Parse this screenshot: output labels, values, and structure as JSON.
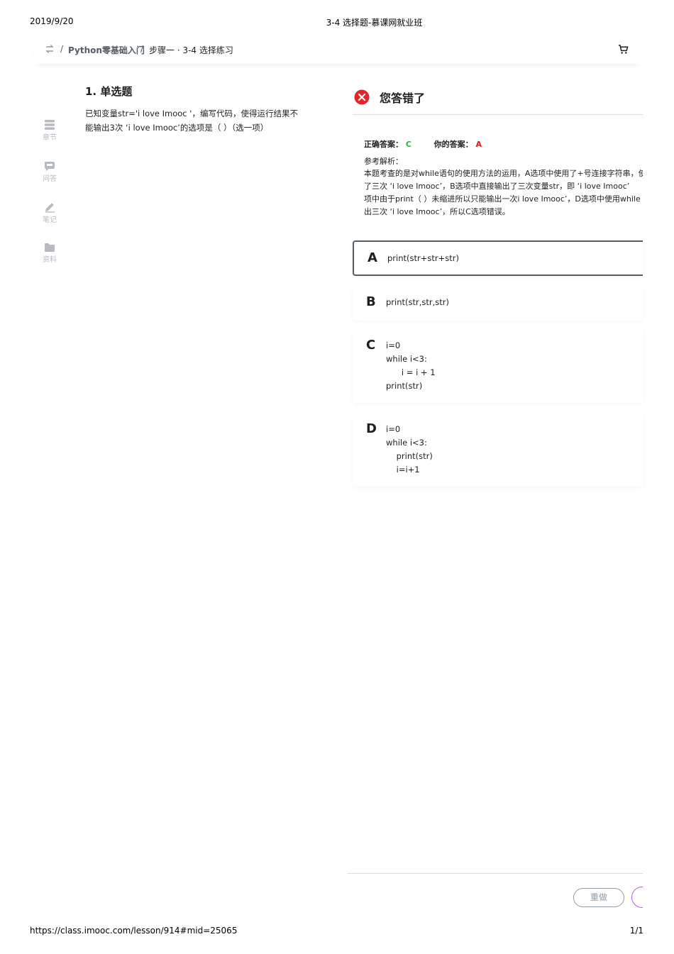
{
  "print": {
    "date": "2019/9/20",
    "title": "3-4 选择题-慕课网就业班",
    "url": "https://class.imooc.com/lesson/914#mid=25065",
    "page": "1/1"
  },
  "breadcrumb": {
    "sep": "/",
    "course": "Python零基础入门",
    "lesson": "步骤一 · 3-4 选择练习"
  },
  "sidebar": {
    "items": [
      {
        "label": "章节",
        "icon": "chapter-icon"
      },
      {
        "label": "问答",
        "icon": "qa-icon"
      },
      {
        "label": "笔记",
        "icon": "pencil-icon"
      },
      {
        "label": "资料",
        "icon": "folder-icon"
      }
    ]
  },
  "question": {
    "title": "1. 单选题",
    "text": "已知变量str='i love Imooc '，编写代码，使得运行结果不能输出3次 ‘i love Imooc’的选项是（ ）（选一项）"
  },
  "result": {
    "status": "您答错了",
    "correct_label": "正确答案：",
    "correct_value": "C",
    "yours_label": "你的答案：",
    "yours_value": "A",
    "analysis_label": "参考解析：",
    "analysis_lines": [
      "本题考查的是对while语句的使用方法的运用，A选项中使用了+号连接字符串，使",
      "了三次 ‘i love Imooc’，B选项中直接输出了三次变量str，即 ‘i love Imooc’",
      "项中由于print（ ）未缩进所以只能输出一次i love Imooc’，D选项中使用while",
      "出三次 ‘i love Imooc’，所以C选项错误。"
    ]
  },
  "options": [
    {
      "letter": "A",
      "text": "print(str+str+str)"
    },
    {
      "letter": "B",
      "text": "print(str,str,str)"
    },
    {
      "letter": "C",
      "text": "i=0\nwhile i<3:\n      i = i + 1\nprint(str)"
    },
    {
      "letter": "D",
      "text": "i=0\nwhile i<3:\n    print(str)\n    i=i+1"
    }
  ],
  "actions": {
    "redo": "重做"
  },
  "colors": {
    "correct": "#2cb04b",
    "wrong": "#f01414",
    "next_accent": "#b35cf0"
  }
}
